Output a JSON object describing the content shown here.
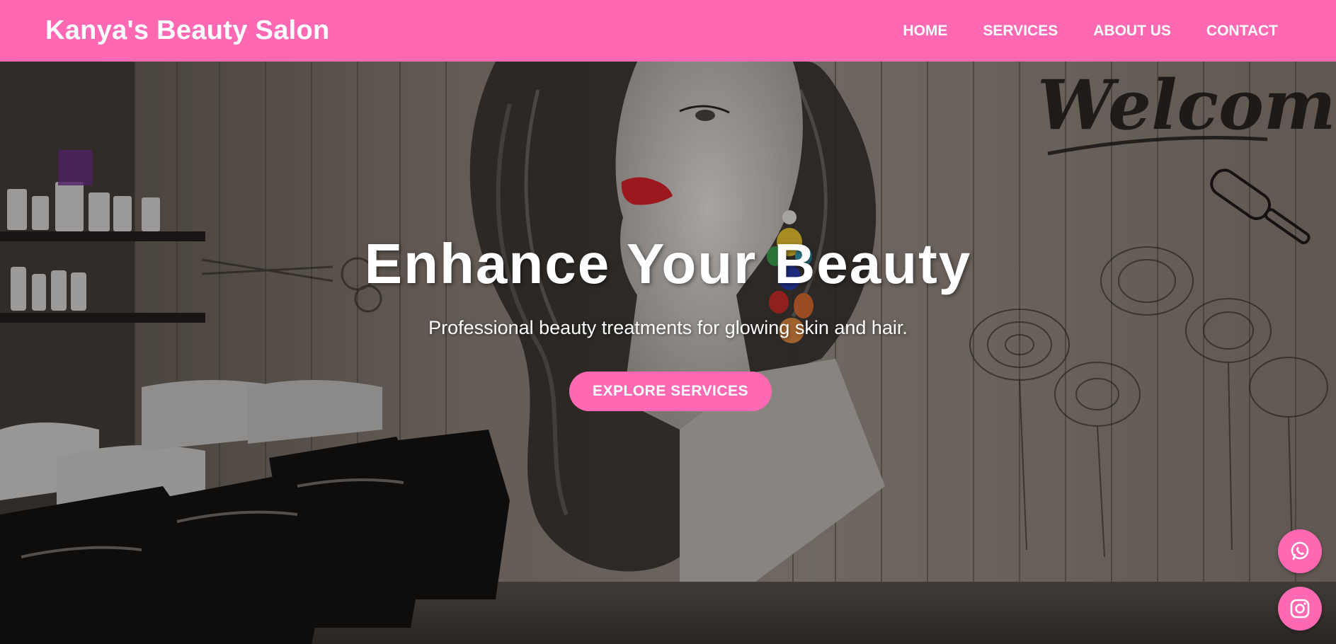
{
  "header": {
    "brand": "Kanya's Beauty Salon",
    "nav": [
      {
        "label": "HOME"
      },
      {
        "label": "SERVICES"
      },
      {
        "label": "ABOUT US"
      },
      {
        "label": "CONTACT"
      }
    ]
  },
  "hero": {
    "title": "Enhance Your Beauty",
    "subtitle": "Professional beauty treatments for glowing skin and hair.",
    "cta_label": "EXPLORE SERVICES",
    "background_icon": "salon-interior-mural",
    "mural_text": "Welcome"
  },
  "floating": {
    "whatsapp_icon": "whatsapp-icon",
    "instagram_icon": "instagram-icon"
  },
  "colors": {
    "accent": "#ff69b4",
    "text_on_accent": "#ffffff",
    "mural_lips": "#d8202a"
  }
}
